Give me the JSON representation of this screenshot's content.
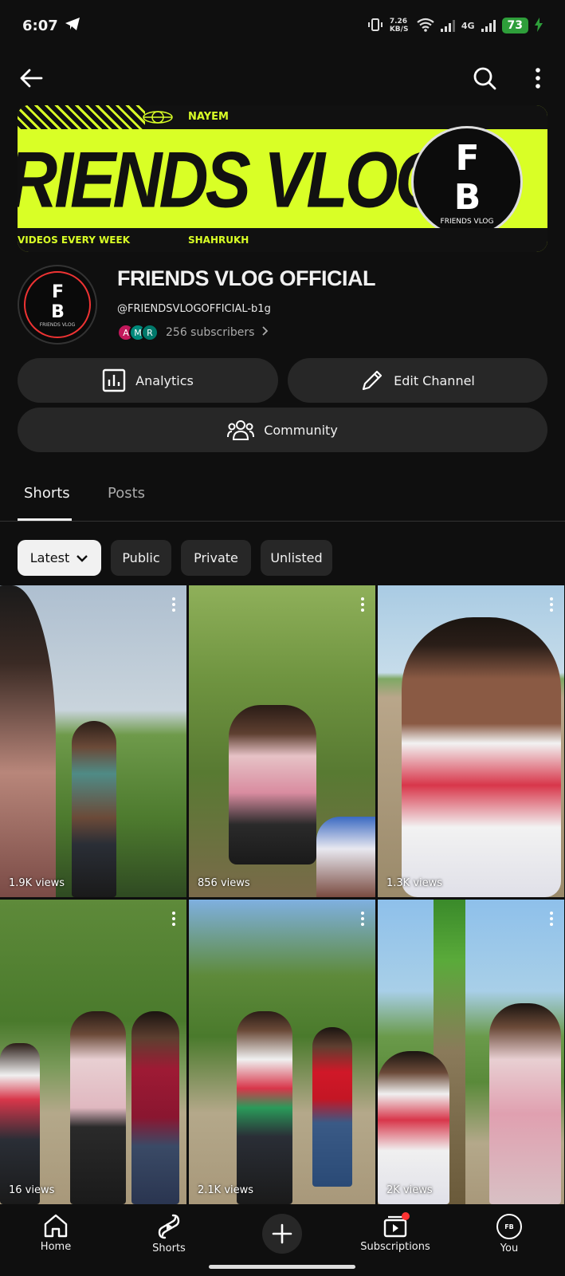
{
  "status": {
    "time": "6:07",
    "net_speed": "7.26 KB/S",
    "network": "4G",
    "battery": "73"
  },
  "banner": {
    "top_name": "NAYEM",
    "title": "RIENDS VLOG",
    "bottom_left": "VIDEOS EVERY WEEK",
    "bottom_right": "SHAHRUKH",
    "logo_letters": "FB",
    "logo_sub": "FRIENDS VLOG"
  },
  "channel": {
    "avatar_letters": "FB",
    "avatar_sub": "FRIENDS VLOG",
    "name": "FRIENDS VLOG OFFICIAL",
    "handle": "@FRIENDSVLOGOFFICIAL-b1g",
    "subscribers": "256 subscribers",
    "subscriber_avatars": [
      "A",
      "M",
      "R"
    ]
  },
  "actions": {
    "analytics": "Analytics",
    "edit": "Edit Channel",
    "community": "Community"
  },
  "tabs": [
    "Shorts",
    "Posts"
  ],
  "filters": {
    "latest": "Latest",
    "public": "Public",
    "private": "Private",
    "unlisted": "Unlisted"
  },
  "shorts": [
    {
      "views": "1.9K views"
    },
    {
      "views": "856 views"
    },
    {
      "views": "1.3K views"
    },
    {
      "views": "16 views"
    },
    {
      "views": "2.1K views"
    },
    {
      "views": "2K views"
    }
  ],
  "nav": {
    "home": "Home",
    "shorts": "Shorts",
    "subscriptions": "Subscriptions",
    "you": "You"
  },
  "colors": {
    "background": "#0f0f0f",
    "banner_accent": "#d9ff26",
    "surface": "#272727"
  }
}
